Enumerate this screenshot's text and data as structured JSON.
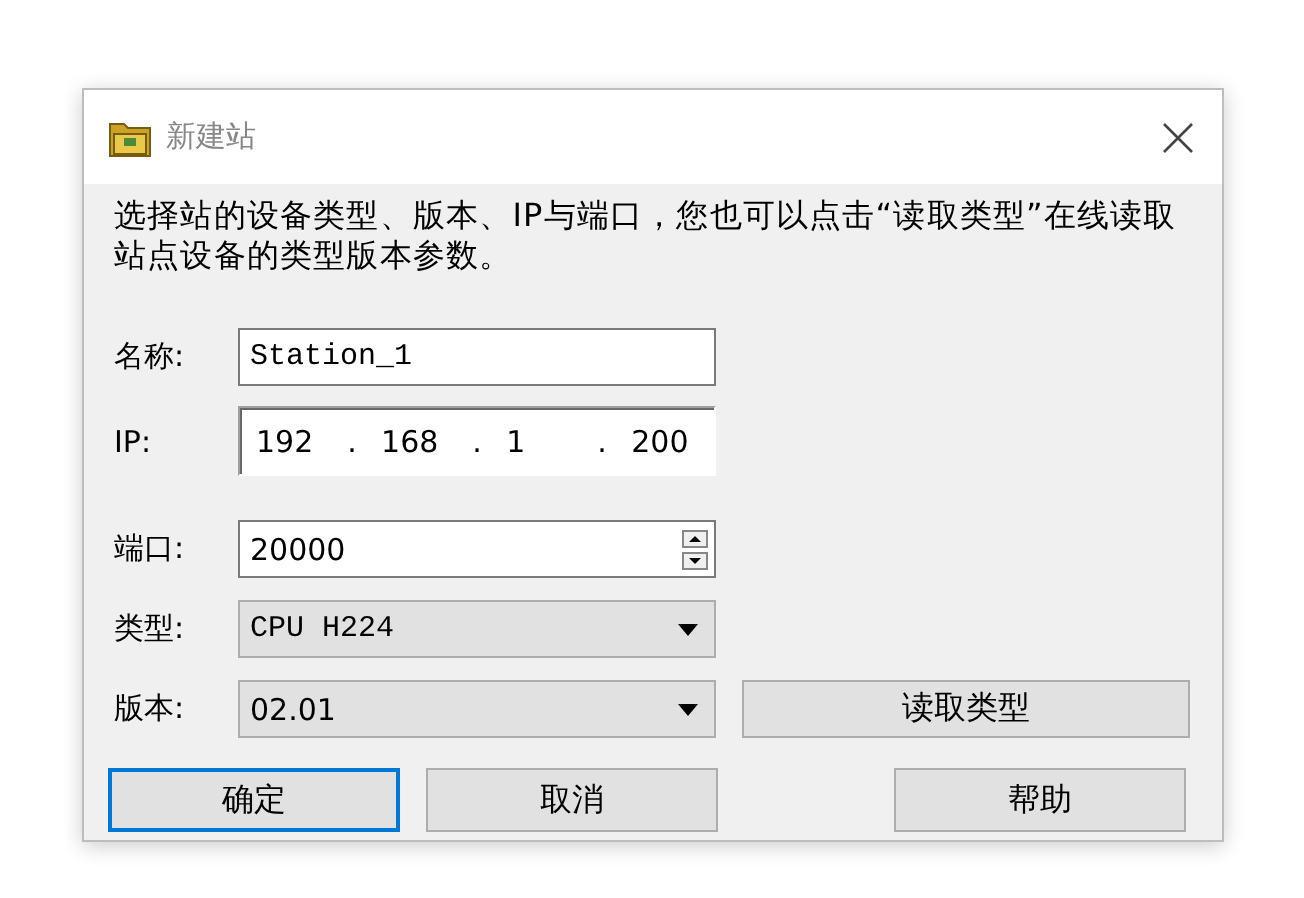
{
  "window": {
    "title": "新建站"
  },
  "description": "选择站的设备类型、版本、IP与端口，您也可以点击“读取类型”在线读取站点设备的类型版本参数。",
  "name_field": {
    "label": "名称:",
    "value": "Station_1"
  },
  "ip_field": {
    "label": "IP:",
    "segments": [
      "192",
      "168",
      "1",
      "200"
    ],
    "separator": "."
  },
  "port_field": {
    "label": "端口:",
    "value": "20000"
  },
  "type_field": {
    "label": "类型:",
    "value": "CPU H224"
  },
  "version_field": {
    "label": "版本:",
    "value": "02.01"
  },
  "read_type_button": {
    "label": "读取类型"
  },
  "buttons": [
    {
      "label": "确定",
      "default": true
    },
    {
      "label": "取消",
      "default": false
    },
    {
      "label": "帮助",
      "default": false
    }
  ]
}
